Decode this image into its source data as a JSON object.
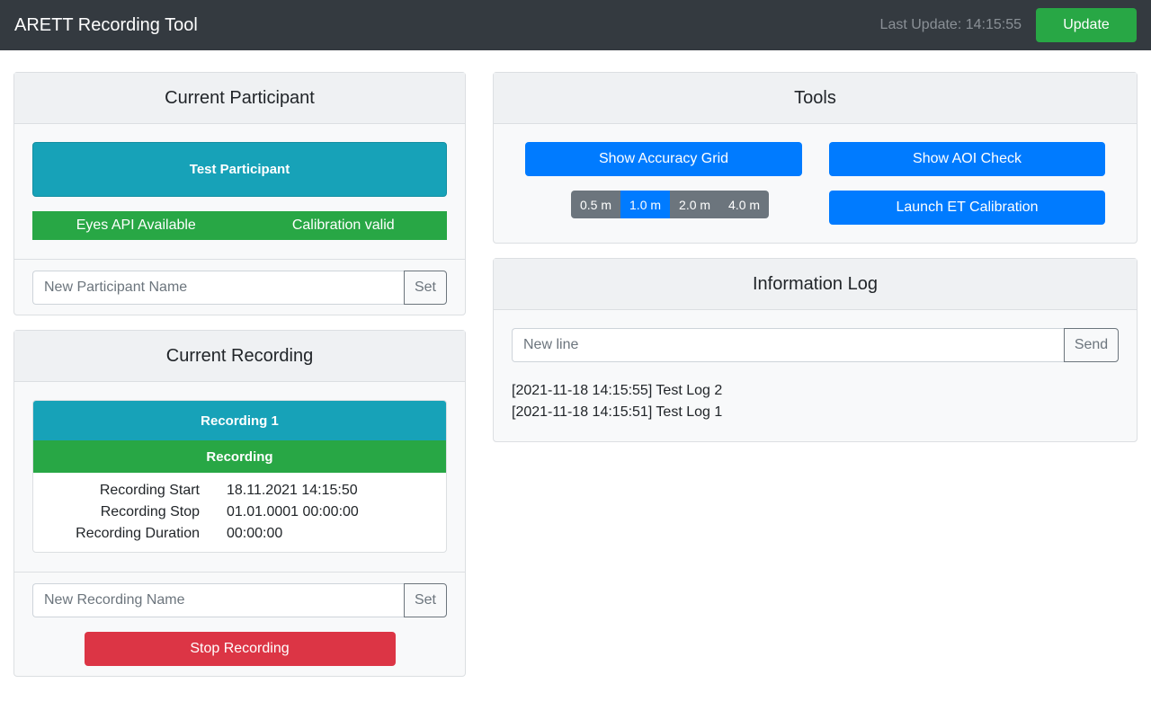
{
  "navbar": {
    "brand": "ARETT Recording Tool",
    "last_update": "Last Update: 14:15:55",
    "update_label": "Update"
  },
  "participant": {
    "header": "Current Participant",
    "name": "Test Participant",
    "status_left": "Eyes API Available",
    "status_right": "Calibration valid",
    "input_placeholder": "New Participant Name",
    "set_label": "Set"
  },
  "recording": {
    "header": "Current Recording",
    "title": "Recording 1",
    "status": "Recording",
    "rows": [
      {
        "label": "Recording Start",
        "value": "18.11.2021 14:15:50"
      },
      {
        "label": "Recording Stop",
        "value": "01.01.0001 00:00:00"
      },
      {
        "label": "Recording Duration",
        "value": "00:00:00"
      }
    ],
    "input_placeholder": "New Recording Name",
    "set_label": "Set",
    "stop_label": "Stop Recording"
  },
  "tools": {
    "header": "Tools",
    "accuracy_grid_label": "Show Accuracy Grid",
    "aoi_check_label": "Show AOI Check",
    "calibration_label": "Launch ET Calibration",
    "distances": [
      "0.5 m",
      "1.0 m",
      "2.0 m",
      "4.0 m"
    ],
    "selected_distance": "1.0 m"
  },
  "log": {
    "header": "Information Log",
    "input_placeholder": "New line",
    "send_label": "Send",
    "lines": [
      "[2021-11-18 14:15:55] Test Log 2",
      "[2021-11-18 14:15:51] Test Log 1"
    ]
  },
  "colors": {
    "navbar": "#343a40",
    "success": "#28a745",
    "info": "#17a2b8",
    "primary": "#007bff",
    "danger": "#dc3545",
    "secondary": "#6c757d"
  }
}
